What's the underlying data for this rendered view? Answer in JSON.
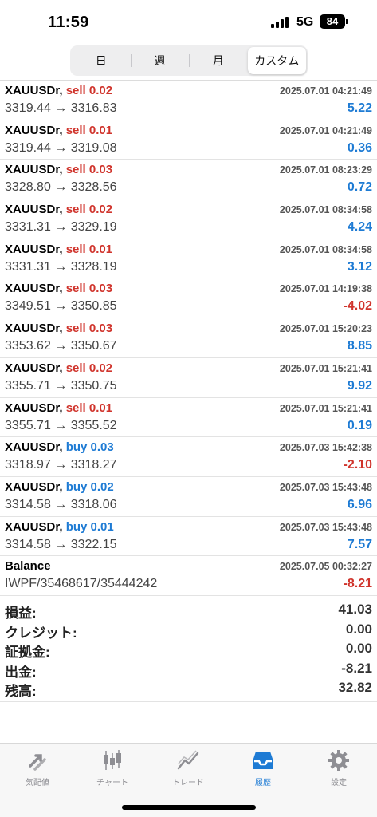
{
  "status_bar": {
    "time": "11:59",
    "network": "5G",
    "battery": "84"
  },
  "segments": [
    {
      "label": "日",
      "active": false
    },
    {
      "label": "週",
      "active": false
    },
    {
      "label": "月",
      "active": false
    },
    {
      "label": "カスタム",
      "active": true
    }
  ],
  "trades": [
    {
      "symbol": "XAUUSDr,",
      "side": "sell",
      "lots": "0.02",
      "date": "2025.07.01 04:21:49",
      "prices": "3319.44 → 3316.83",
      "profit": "5.22"
    },
    {
      "symbol": "XAUUSDr,",
      "side": "sell",
      "lots": "0.01",
      "date": "2025.07.01 04:21:49",
      "prices": "3319.44 → 3319.08",
      "profit": "0.36"
    },
    {
      "symbol": "XAUUSDr,",
      "side": "sell",
      "lots": "0.03",
      "date": "2025.07.01 08:23:29",
      "prices": "3328.80 → 3328.56",
      "profit": "0.72"
    },
    {
      "symbol": "XAUUSDr,",
      "side": "sell",
      "lots": "0.02",
      "date": "2025.07.01 08:34:58",
      "prices": "3331.31 → 3329.19",
      "profit": "4.24"
    },
    {
      "symbol": "XAUUSDr,",
      "side": "sell",
      "lots": "0.01",
      "date": "2025.07.01 08:34:58",
      "prices": "3331.31 → 3328.19",
      "profit": "3.12"
    },
    {
      "symbol": "XAUUSDr,",
      "side": "sell",
      "lots": "0.03",
      "date": "2025.07.01 14:19:38",
      "prices": "3349.51 → 3350.85",
      "profit": "-4.02"
    },
    {
      "symbol": "XAUUSDr,",
      "side": "sell",
      "lots": "0.03",
      "date": "2025.07.01 15:20:23",
      "prices": "3353.62 → 3350.67",
      "profit": "8.85"
    },
    {
      "symbol": "XAUUSDr,",
      "side": "sell",
      "lots": "0.02",
      "date": "2025.07.01 15:21:41",
      "prices": "3355.71 → 3350.75",
      "profit": "9.92"
    },
    {
      "symbol": "XAUUSDr,",
      "side": "sell",
      "lots": "0.01",
      "date": "2025.07.01 15:21:41",
      "prices": "3355.71 → 3355.52",
      "profit": "0.19"
    },
    {
      "symbol": "XAUUSDr,",
      "side": "buy",
      "lots": "0.03",
      "date": "2025.07.03 15:42:38",
      "prices": "3318.97 → 3318.27",
      "profit": "-2.10"
    },
    {
      "symbol": "XAUUSDr,",
      "side": "buy",
      "lots": "0.02",
      "date": "2025.07.03 15:43:48",
      "prices": "3314.58 → 3318.06",
      "profit": "6.96"
    },
    {
      "symbol": "XAUUSDr,",
      "side": "buy",
      "lots": "0.01",
      "date": "2025.07.03 15:43:48",
      "prices": "3314.58 → 3322.15",
      "profit": "7.57"
    }
  ],
  "balance_entry": {
    "title": "Balance",
    "date": "2025.07.05 00:32:27",
    "comment": "IWPF/35468617/35444242",
    "amount": "-8.21"
  },
  "summary": [
    {
      "label": "損益:",
      "value": "41.03"
    },
    {
      "label": "クレジット:",
      "value": "0.00"
    },
    {
      "label": "証拠金:",
      "value": "0.00"
    },
    {
      "label": "出金:",
      "value": "-8.21"
    },
    {
      "label": "残高:",
      "value": "32.82"
    }
  ],
  "tab_bar": [
    {
      "label": "気配値",
      "icon": "quotes-arrows-icon",
      "active": false
    },
    {
      "label": "チャート",
      "icon": "candlestick-chart-icon",
      "active": false
    },
    {
      "label": "トレード",
      "icon": "trade-line-icon",
      "active": false
    },
    {
      "label": "履歴",
      "icon": "inbox-history-icon",
      "active": true
    },
    {
      "label": "設定",
      "icon": "gear-icon",
      "active": false
    }
  ],
  "colors": {
    "sell": "#d0342c",
    "buy": "#1e7bd4",
    "positive": "#1e7bd4",
    "negative": "#d0342c",
    "tab_active": "#1e7bd4",
    "tab_inactive": "#8e8e93"
  }
}
